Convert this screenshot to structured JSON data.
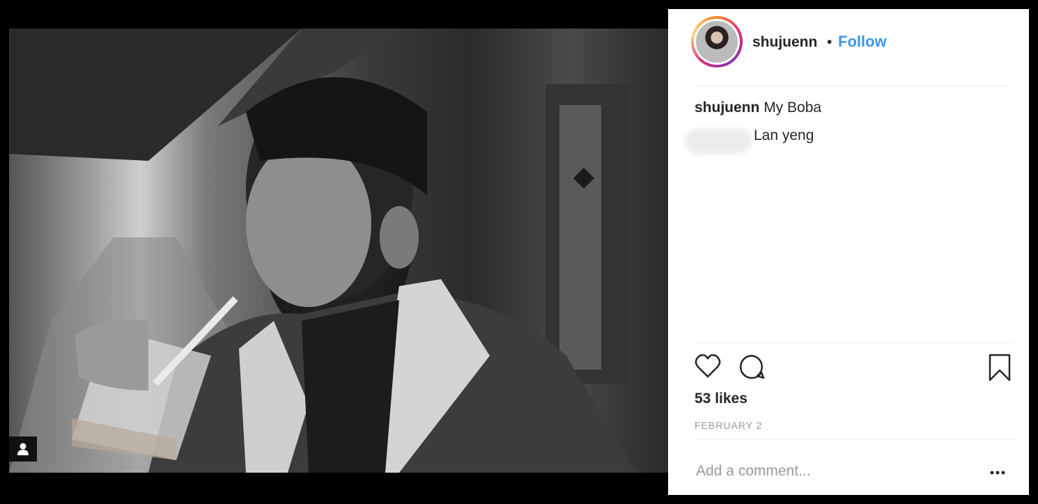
{
  "post": {
    "username": "shujuenn",
    "separator": "•",
    "follow_label": "Follow",
    "caption_text": "My Boba",
    "mention_text": "Lan yeng",
    "likes": "53 likes",
    "date": "FEBRUARY 2",
    "comment_placeholder": "Add a comment..."
  },
  "colors": {
    "accent": "#3897f0",
    "text": "#262626",
    "muted": "#999999",
    "divider": "#efefef"
  },
  "icons": {
    "like": "heart-icon",
    "comment": "comment-bubble-icon",
    "save": "bookmark-icon",
    "more": "ellipsis-icon",
    "tag": "user-tag-icon"
  }
}
